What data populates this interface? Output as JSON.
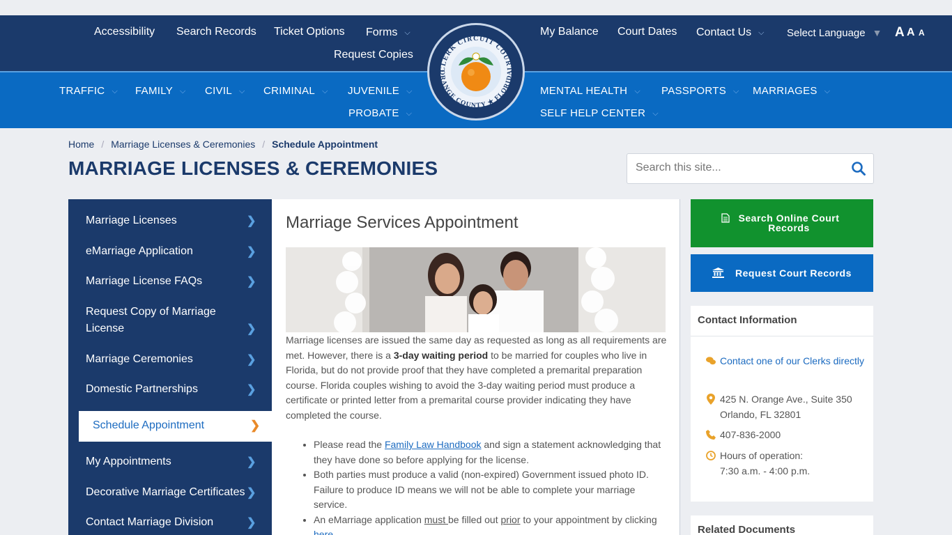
{
  "top_nav_left": [
    {
      "label": "Accessibility"
    },
    {
      "label": "Search Records"
    },
    {
      "label": "Ticket Options"
    },
    {
      "label": "Forms"
    },
    {
      "label": "Request Copies"
    }
  ],
  "top_nav_right": [
    {
      "label": "My Balance"
    },
    {
      "label": "Court Dates"
    },
    {
      "label": "Contact Us"
    }
  ],
  "language": {
    "label": "Select Language"
  },
  "font_size": {
    "large": "A",
    "medium": "A",
    "small": "A"
  },
  "seal": {
    "top_text": "CLERK CIRCUIT COURT",
    "bottom_text": "ORANGE COUNTY ★ FLORIDA"
  },
  "main_nav_left": [
    {
      "label": "TRAFFIC"
    },
    {
      "label": "FAMILY"
    },
    {
      "label": "CIVIL"
    },
    {
      "label": "CRIMINAL"
    },
    {
      "label": "JUVENILE"
    },
    {
      "label": "PROBATE"
    }
  ],
  "main_nav_right": [
    {
      "label": "MENTAL HEALTH"
    },
    {
      "label": "PASSPORTS"
    },
    {
      "label": "MARRIAGES"
    },
    {
      "label": "SELF HELP CENTER"
    }
  ],
  "breadcrumb": {
    "home": "Home",
    "section": "Marriage Licenses & Ceremonies",
    "current": "Schedule Appointment"
  },
  "page_title": "MARRIAGE LICENSES & CEREMONIES",
  "search": {
    "placeholder": "Search this site..."
  },
  "sidebar": [
    {
      "label": "Marriage Licenses"
    },
    {
      "label": "eMarriage Application"
    },
    {
      "label": "Marriage License FAQs"
    },
    {
      "label": "Request Copy of Marriage License"
    },
    {
      "label": "Marriage Ceremonies"
    },
    {
      "label": "Domestic Partnerships"
    },
    {
      "label": "Schedule Appointment"
    },
    {
      "label": "My Appointments"
    },
    {
      "label": "Decorative Marriage Certificates"
    },
    {
      "label": "Contact Marriage Division"
    }
  ],
  "article": {
    "title": "Marriage Services Appointment",
    "intro_1": "Marriage licenses are issued the same day as requested as long as all requirements are met. However, there is a ",
    "intro_bold": "3-day waiting period",
    "intro_2": " to be married for couples who live in Florida, but do not provide proof that they have completed a premarital preparation course. Florida couples wishing to avoid the 3-day waiting period must produce a certificate or printed letter from a premarital course provider indicating they have completed the course.",
    "bullet1_a": "Please read the ",
    "bullet1_link": "Family Law Handbook",
    "bullet1_b": " and sign a statement acknowledging that they have done so before applying for the license.",
    "bullet2": "Both parties must produce a valid (non-expired) Government issued photo ID. Failure to produce ID means we will not be able to complete your marriage service.",
    "bullet3_a": "An eMarriage application ",
    "bullet3_must": "must ",
    "bullet3_b": "be filled out ",
    "bullet3_prior": "prior",
    "bullet3_c": " to your appointment by clicking ",
    "bullet3_link": "here"
  },
  "buttons": {
    "search_records": "Search Online Court Records",
    "request_records": "Request Court Records"
  },
  "contact": {
    "heading": "Contact Information",
    "clerk_link": "Contact one of our Clerks directly",
    "address_1": "425 N. Orange Ave., Suite 350",
    "address_2": "Orlando, FL 32801",
    "phone": "407-836-2000",
    "hours_label": "Hours of operation:",
    "hours": "7:30 a.m. - 4:00 p.m."
  },
  "related": {
    "heading": "Related Documents"
  },
  "colors": {
    "navy": "#1b3a6b",
    "blue": "#0a6ac2",
    "green": "#11922e",
    "orange": "#e98a2a"
  }
}
